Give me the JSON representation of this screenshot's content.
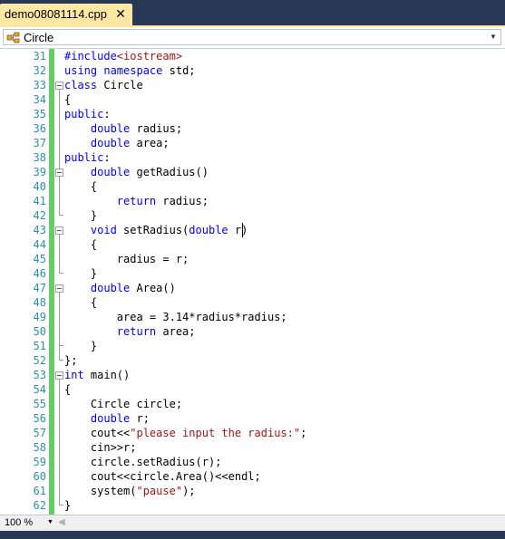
{
  "tab": {
    "title": "demo08081114.cpp",
    "close": "✕"
  },
  "navbar": {
    "scope": "Circle",
    "arrow": "▼"
  },
  "statusbar": {
    "zoom": "100 %",
    "zoom_arrow": "▼",
    "scroll_left": "◀"
  },
  "colors": {
    "keyword": "#0000FF",
    "string": "#A31515",
    "line_number": "#2B91AF",
    "tab_active": "#FFE8A6",
    "chrome": "#293955",
    "change_bar": "#66CC66"
  },
  "lines": [
    {
      "n": "31",
      "fold": "",
      "parts": [
        {
          "c": "k",
          "t": "#include"
        },
        {
          "c": "s",
          "t": "<iostream>"
        }
      ]
    },
    {
      "n": "32",
      "fold": "",
      "parts": [
        {
          "c": "k",
          "t": "using"
        },
        {
          "c": "t",
          "t": " "
        },
        {
          "c": "k",
          "t": "namespace"
        },
        {
          "c": "t",
          "t": " std;"
        }
      ]
    },
    {
      "n": "33",
      "fold": "box",
      "parts": [
        {
          "c": "k",
          "t": "class"
        },
        {
          "c": "t",
          "t": " Circle"
        }
      ]
    },
    {
      "n": "34",
      "fold": "line",
      "parts": [
        {
          "c": "t",
          "t": "{"
        }
      ]
    },
    {
      "n": "35",
      "fold": "line",
      "parts": [
        {
          "c": "k",
          "t": "public"
        },
        {
          "c": "t",
          "t": ":"
        }
      ]
    },
    {
      "n": "36",
      "fold": "line",
      "parts": [
        {
          "c": "t",
          "t": "    "
        },
        {
          "c": "k",
          "t": "double"
        },
        {
          "c": "t",
          "t": " radius;"
        }
      ]
    },
    {
      "n": "37",
      "fold": "line",
      "parts": [
        {
          "c": "t",
          "t": "    "
        },
        {
          "c": "k",
          "t": "double"
        },
        {
          "c": "t",
          "t": " area;"
        }
      ]
    },
    {
      "n": "38",
      "fold": "line",
      "parts": [
        {
          "c": "k",
          "t": "public"
        },
        {
          "c": "t",
          "t": ":"
        }
      ]
    },
    {
      "n": "39",
      "fold": "box",
      "parts": [
        {
          "c": "t",
          "t": "    "
        },
        {
          "c": "k",
          "t": "double"
        },
        {
          "c": "t",
          "t": " getRadius()"
        }
      ]
    },
    {
      "n": "40",
      "fold": "line",
      "parts": [
        {
          "c": "t",
          "t": "    {"
        }
      ]
    },
    {
      "n": "41",
      "fold": "line",
      "parts": [
        {
          "c": "t",
          "t": "        "
        },
        {
          "c": "k",
          "t": "return"
        },
        {
          "c": "t",
          "t": " radius;"
        }
      ]
    },
    {
      "n": "42",
      "fold": "end",
      "parts": [
        {
          "c": "t",
          "t": "    }"
        }
      ]
    },
    {
      "n": "43",
      "fold": "box",
      "parts": [
        {
          "c": "t",
          "t": "    "
        },
        {
          "c": "k",
          "t": "void"
        },
        {
          "c": "t",
          "t": " setRadius("
        },
        {
          "c": "k",
          "t": "double"
        },
        {
          "c": "t",
          "t": " r)"
        }
      ]
    },
    {
      "n": "44",
      "fold": "line",
      "parts": [
        {
          "c": "t",
          "t": "    {"
        }
      ]
    },
    {
      "n": "45",
      "fold": "line",
      "parts": [
        {
          "c": "t",
          "t": "        radius = r;"
        }
      ]
    },
    {
      "n": "46",
      "fold": "end",
      "parts": [
        {
          "c": "t",
          "t": "    }"
        }
      ]
    },
    {
      "n": "47",
      "fold": "box",
      "parts": [
        {
          "c": "t",
          "t": "    "
        },
        {
          "c": "k",
          "t": "double"
        },
        {
          "c": "t",
          "t": " Area()"
        }
      ]
    },
    {
      "n": "48",
      "fold": "line",
      "parts": [
        {
          "c": "t",
          "t": "    {"
        }
      ]
    },
    {
      "n": "49",
      "fold": "line",
      "parts": [
        {
          "c": "t",
          "t": "        area = 3.14*radius*radius;"
        }
      ]
    },
    {
      "n": "50",
      "fold": "line",
      "parts": [
        {
          "c": "t",
          "t": "        "
        },
        {
          "c": "k",
          "t": "return"
        },
        {
          "c": "t",
          "t": " area;"
        }
      ]
    },
    {
      "n": "51",
      "fold": "end",
      "parts": [
        {
          "c": "t",
          "t": "    }"
        }
      ]
    },
    {
      "n": "52",
      "fold": "end",
      "parts": [
        {
          "c": "t",
          "t": "};"
        }
      ]
    },
    {
      "n": "53",
      "fold": "box",
      "parts": [
        {
          "c": "k",
          "t": "int"
        },
        {
          "c": "t",
          "t": " main()"
        }
      ]
    },
    {
      "n": "54",
      "fold": "line",
      "parts": [
        {
          "c": "t",
          "t": "{"
        }
      ]
    },
    {
      "n": "55",
      "fold": "line",
      "parts": [
        {
          "c": "t",
          "t": "    Circle circle;"
        }
      ]
    },
    {
      "n": "56",
      "fold": "line",
      "parts": [
        {
          "c": "t",
          "t": "    "
        },
        {
          "c": "k",
          "t": "double"
        },
        {
          "c": "t",
          "t": " r;"
        }
      ]
    },
    {
      "n": "57",
      "fold": "line",
      "parts": [
        {
          "c": "t",
          "t": "    cout<<"
        },
        {
          "c": "s",
          "t": "\"please input the radius:\""
        },
        {
          "c": "t",
          "t": ";"
        }
      ]
    },
    {
      "n": "58",
      "fold": "line",
      "parts": [
        {
          "c": "t",
          "t": "    cin>>r;"
        }
      ]
    },
    {
      "n": "59",
      "fold": "line",
      "parts": [
        {
          "c": "t",
          "t": "    circle.setRadius(r);"
        }
      ]
    },
    {
      "n": "60",
      "fold": "line",
      "parts": [
        {
          "c": "t",
          "t": "    cout<<circle.Area()<<endl;"
        }
      ]
    },
    {
      "n": "61",
      "fold": "line",
      "parts": [
        {
          "c": "t",
          "t": "    system("
        },
        {
          "c": "s",
          "t": "\"pause\""
        },
        {
          "c": "t",
          "t": ");"
        }
      ]
    },
    {
      "n": "62",
      "fold": "end",
      "parts": [
        {
          "c": "t",
          "t": "}"
        }
      ]
    }
  ]
}
